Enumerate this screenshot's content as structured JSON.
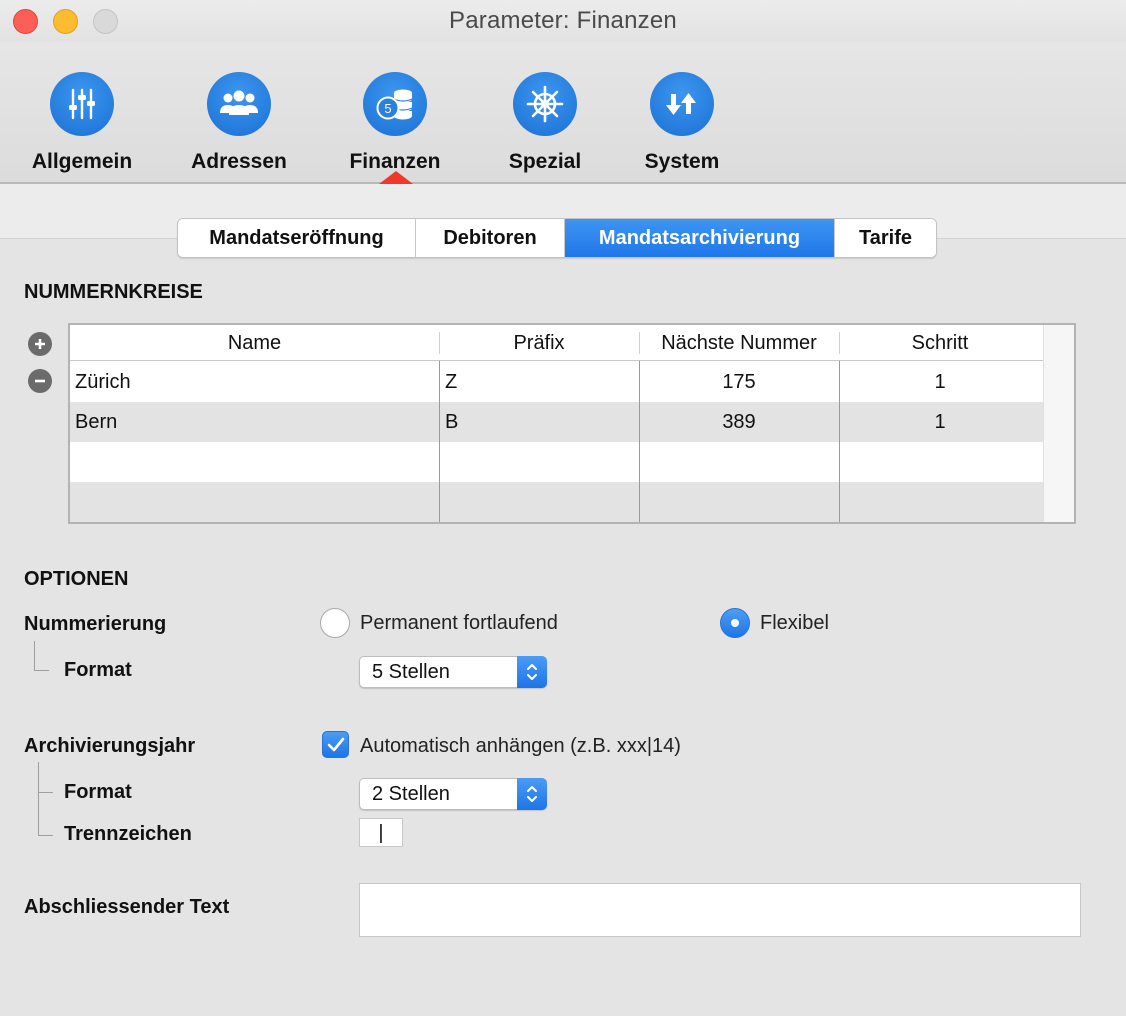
{
  "window": {
    "title": "Parameter: Finanzen"
  },
  "toolbar": {
    "items": [
      {
        "label": "Allgemein",
        "icon": "sliders-icon"
      },
      {
        "label": "Adressen",
        "icon": "people-icon"
      },
      {
        "label": "Finanzen",
        "icon": "coins-icon"
      },
      {
        "label": "Spezial",
        "icon": "ship-wheel-icon"
      },
      {
        "label": "System",
        "icon": "arrows-updown-icon"
      }
    ],
    "selected": "Finanzen"
  },
  "tabs": {
    "items": [
      "Mandatseröffnung",
      "Debitoren",
      "Mandatsarchivierung",
      "Tarife"
    ],
    "active": "Mandatsarchivierung"
  },
  "nummernkreise": {
    "heading": "NUMMERNKREISE",
    "columns": [
      "Name",
      "Präfix",
      "Nächste Nummer",
      "Schritt"
    ],
    "rows": [
      {
        "name": "Zürich",
        "prefix": "Z",
        "next": "175",
        "step": "1"
      },
      {
        "name": "Bern",
        "prefix": "B",
        "next": "389",
        "step": "1"
      }
    ]
  },
  "optionen": {
    "heading": "OPTIONEN",
    "nummerierung": {
      "label": "Nummerierung",
      "option1": "Permanent fortlaufend",
      "option2": "Flexibel",
      "selected": "Flexibel",
      "format_label": "Format",
      "format_value": "5 Stellen"
    },
    "archivierungsjahr": {
      "label": "Archivierungsjahr",
      "checkbox_label": "Automatisch anhängen (z.B. xxx|14)",
      "checked": true,
      "format_label": "Format",
      "format_value": "2 Stellen",
      "separator_label": "Trennzeichen",
      "separator_value": "|"
    },
    "abschliessend": {
      "label": "Abschliessender Text",
      "value": ""
    }
  },
  "colors": {
    "accent": "#1f77e8",
    "close": "#fc5f57",
    "minimize": "#fdbc2e",
    "zoom": "#d9d9d9",
    "pointer": "#f0372c"
  }
}
